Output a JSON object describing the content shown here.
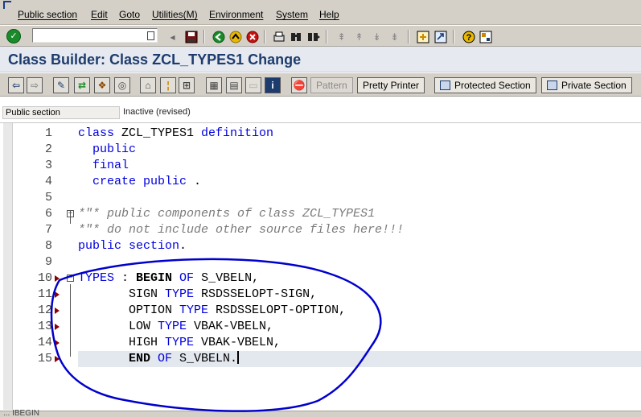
{
  "menu": {
    "items": [
      {
        "label": "Public section"
      },
      {
        "label": "Edit"
      },
      {
        "label": "Goto"
      },
      {
        "label": "Utilities(M)"
      },
      {
        "label": "Environment"
      },
      {
        "label": "System"
      },
      {
        "label": "Help"
      }
    ]
  },
  "std_toolbar": {
    "command_value": "",
    "icons": [
      "enter-icon",
      "save-icon",
      "back-icon",
      "exit-icon",
      "cancel-icon",
      "print-icon",
      "find-icon",
      "find-next-icon",
      "first-page-icon",
      "prev-page-icon",
      "next-page-icon",
      "last-page-icon",
      "create-session-icon",
      "shortcut-icon",
      "help-icon",
      "layout-menu-icon"
    ]
  },
  "title": "Class Builder: Class ZCL_TYPES1 Change",
  "app_toolbar": {
    "buttons": {
      "pattern": "Pattern",
      "pretty_printer": "Pretty Printer",
      "protected_section": "Protected Section",
      "private_section": "Private Section"
    },
    "icons": [
      "back-arrow-icon",
      "forward-arrow-icon",
      "display-change-icon",
      "active-inactive-icon",
      "other-object-icon",
      "check-icon",
      "activate-icon",
      "where-used-icon",
      "navigate-icon",
      "object-list-icon",
      "display-object-list-icon",
      "window-icon",
      "info-icon",
      "stop-icon"
    ]
  },
  "status": {
    "section": "Public section",
    "state": "Inactive (revised)"
  },
  "editor": {
    "lines": [
      {
        "n": "1",
        "segments": [
          {
            "t": "class ",
            "c": "kw"
          },
          {
            "t": "ZCL_TYPES1 ",
            "c": "plain"
          },
          {
            "t": "definition",
            "c": "kw"
          }
        ]
      },
      {
        "n": "2",
        "segments": [
          {
            "t": "  public",
            "c": "kw"
          }
        ]
      },
      {
        "n": "3",
        "segments": [
          {
            "t": "  final",
            "c": "kw"
          }
        ]
      },
      {
        "n": "4",
        "segments": [
          {
            "t": "  create public ",
            "c": "kw"
          },
          {
            "t": ".",
            "c": "plain"
          }
        ]
      },
      {
        "n": "5",
        "segments": []
      },
      {
        "n": "6",
        "segments": [
          {
            "t": "*\"* public components of class ZCL_TYPES1",
            "c": "cm"
          }
        ]
      },
      {
        "n": "7",
        "segments": [
          {
            "t": "*\"* do not include other source files here!!!",
            "c": "cm"
          }
        ]
      },
      {
        "n": "8",
        "segments": [
          {
            "t": "public section",
            "c": "kw"
          },
          {
            "t": ".",
            "c": "plain"
          }
        ]
      },
      {
        "n": "9",
        "segments": []
      },
      {
        "n": "10",
        "segments": [
          {
            "t": "TYPES ",
            "c": "kw"
          },
          {
            "t": ": ",
            "c": "plain"
          },
          {
            "t": "BEGIN ",
            "c": "kwb"
          },
          {
            "t": "OF ",
            "c": "kw"
          },
          {
            "t": "S_VBELN,",
            "c": "plain"
          }
        ]
      },
      {
        "n": "11",
        "segments": [
          {
            "t": "       SIGN ",
            "c": "plain"
          },
          {
            "t": "TYPE ",
            "c": "kw"
          },
          {
            "t": "RSDSSELOPT-SIGN,",
            "c": "plain"
          }
        ]
      },
      {
        "n": "12",
        "segments": [
          {
            "t": "       OPTION ",
            "c": "plain"
          },
          {
            "t": "TYPE ",
            "c": "kw"
          },
          {
            "t": "RSDSSELOPT-OPTION,",
            "c": "plain"
          }
        ]
      },
      {
        "n": "13",
        "segments": [
          {
            "t": "       LOW ",
            "c": "plain"
          },
          {
            "t": "TYPE ",
            "c": "kw"
          },
          {
            "t": "VBAK-VBELN,",
            "c": "plain"
          }
        ]
      },
      {
        "n": "14",
        "segments": [
          {
            "t": "       HIGH ",
            "c": "plain"
          },
          {
            "t": "TYPE ",
            "c": "kw"
          },
          {
            "t": "VBAK-VBELN,",
            "c": "plain"
          }
        ]
      },
      {
        "n": "15",
        "segments": [
          {
            "t": "       END ",
            "c": "kwb"
          },
          {
            "t": "OF ",
            "c": "kw"
          },
          {
            "t": "S_VBELN.",
            "c": "plain"
          }
        ]
      }
    ]
  },
  "bottom_status": "... IBEGIN",
  "colors": {
    "keyword": "#0000e0",
    "comment": "#7a7a7a",
    "title": "#1d3c6e",
    "annotation": "#0000cc"
  }
}
